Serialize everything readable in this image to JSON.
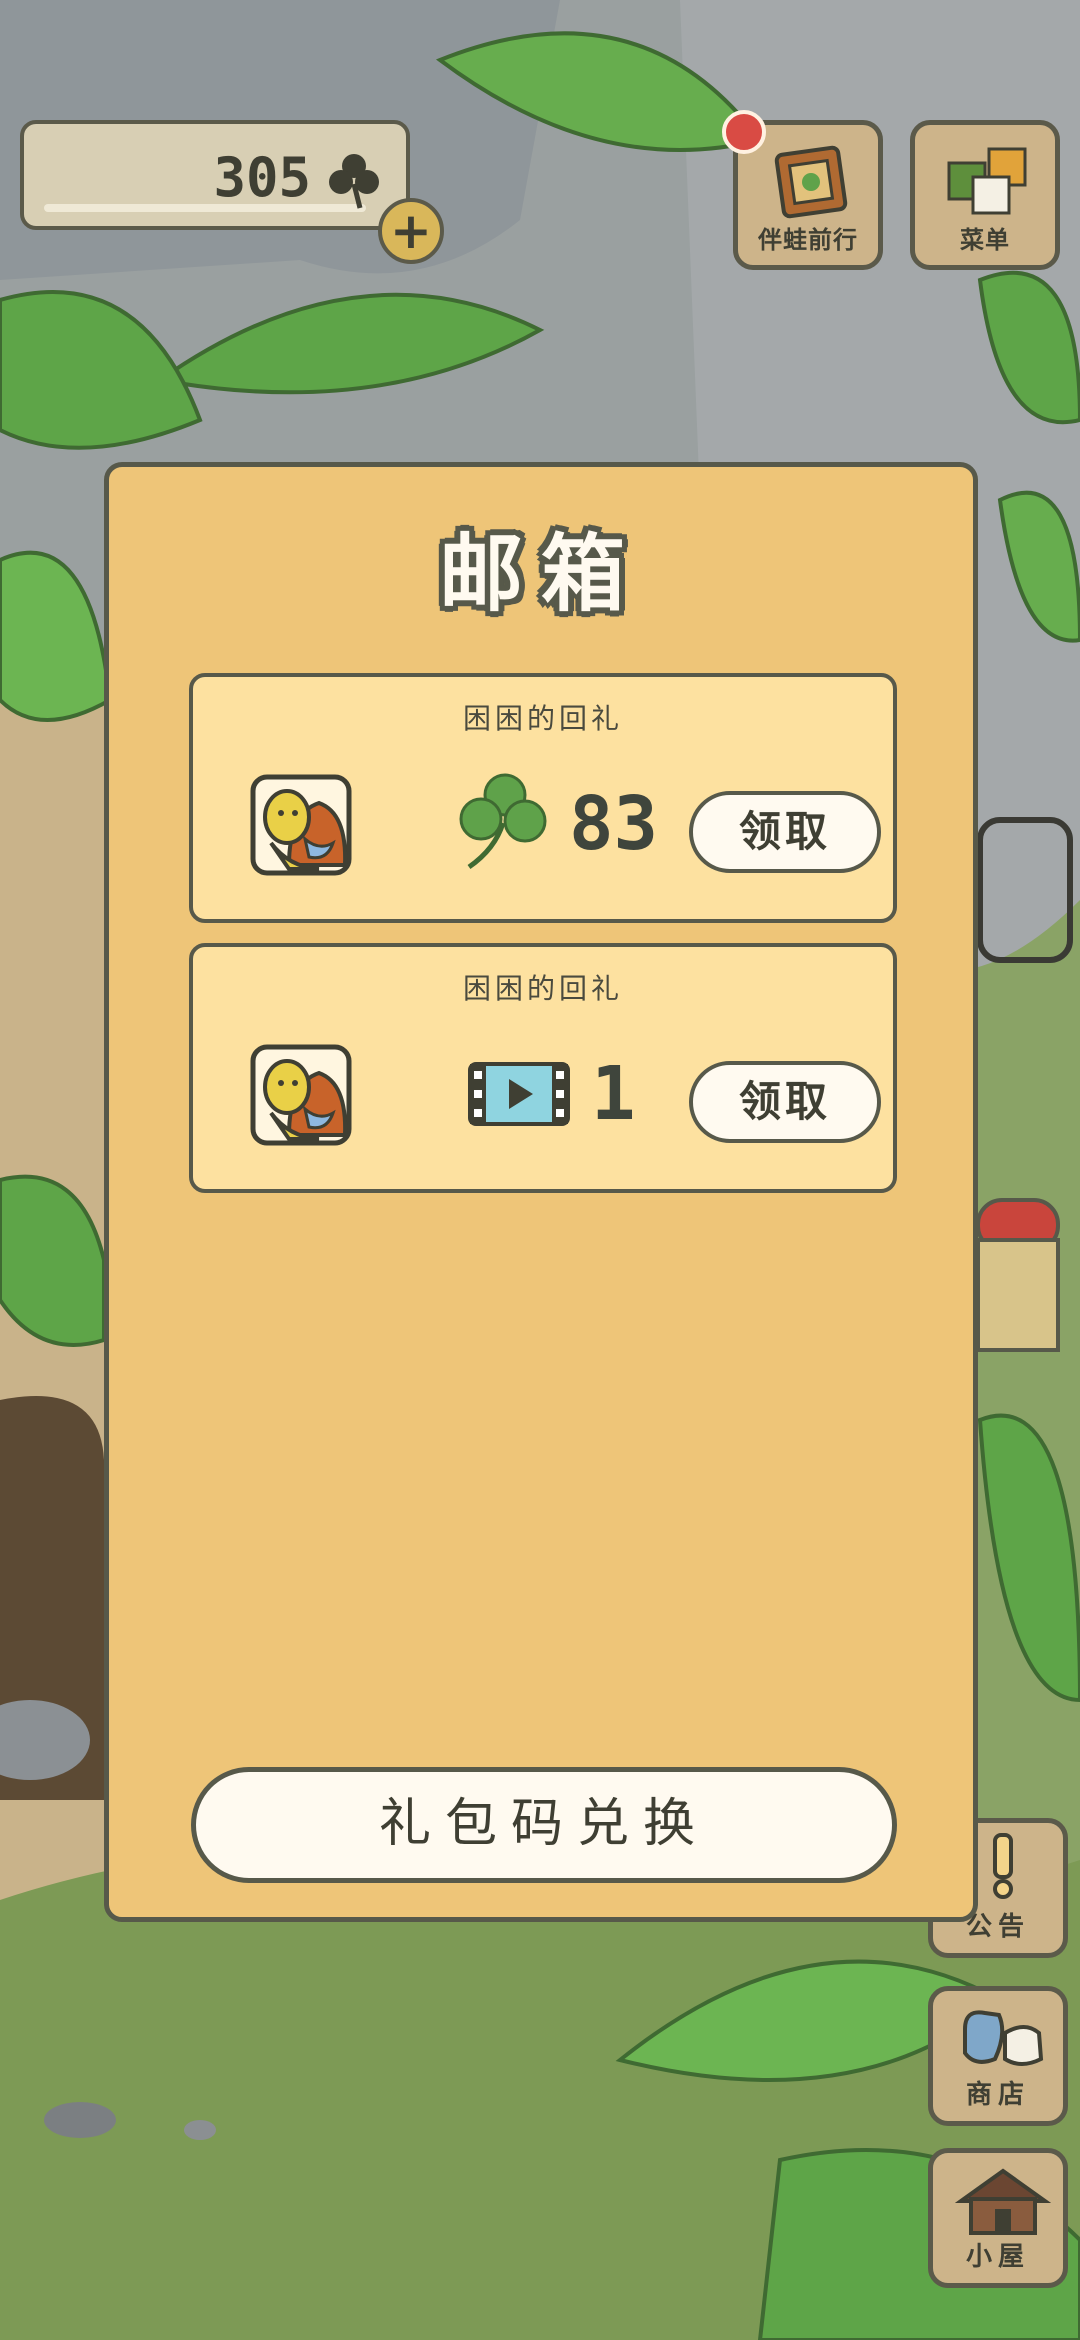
{
  "hud": {
    "clover_count": "305"
  },
  "top_buttons": {
    "travel_label": "伴蛙前行",
    "menu_label": "菜单"
  },
  "side_buttons": {
    "notice_label": "公告",
    "shop_label": "商店",
    "house_label": "小屋"
  },
  "mailbox": {
    "title": "邮箱",
    "items": [
      {
        "sender": "困困的回礼",
        "reward_icon": "clover-icon",
        "amount": "83",
        "claim_label": "领取"
      },
      {
        "sender": "困困的回礼",
        "reward_icon": "video-ticket-icon",
        "amount": "1",
        "claim_label": "领取"
      }
    ],
    "redeem_label": "礼包码兑换"
  },
  "colors": {
    "modal_bg": "#eec578",
    "mail_item_bg": "#fde1a0",
    "outline": "#57594a",
    "button_bg": "#fffaf0",
    "notification_red": "#d94b44",
    "clover_green": "#5fa24a"
  }
}
